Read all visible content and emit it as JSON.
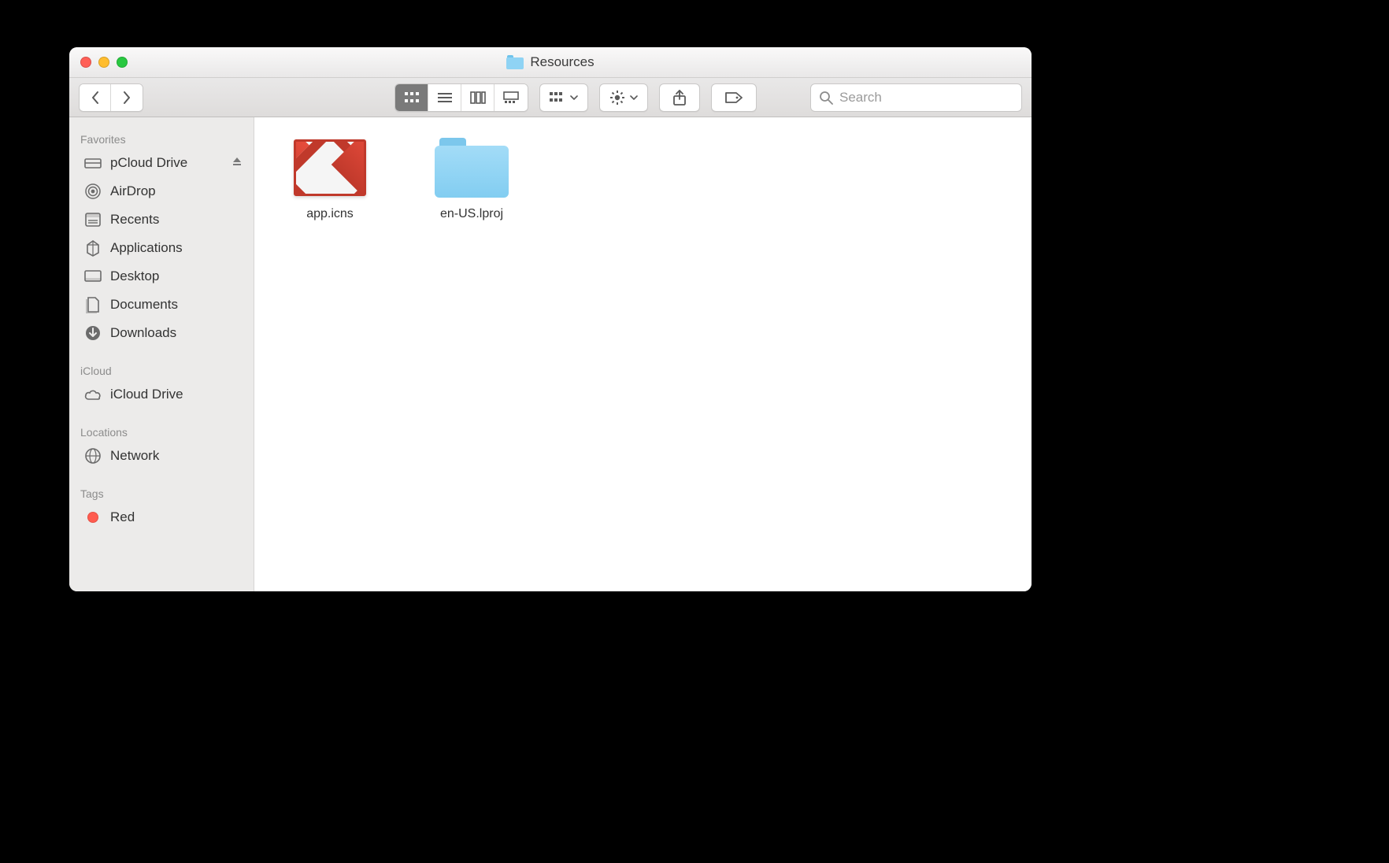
{
  "window_title": "Resources",
  "search": {
    "placeholder": "Search"
  },
  "sidebar": {
    "sections": {
      "favorites_label": "Favorites",
      "icloud_label": "iCloud",
      "locations_label": "Locations",
      "tags_label": "Tags"
    },
    "favorites": [
      {
        "label": "pCloud Drive",
        "icon": "drive",
        "ejectable": true
      },
      {
        "label": "AirDrop",
        "icon": "airdrop"
      },
      {
        "label": "Recents",
        "icon": "recents"
      },
      {
        "label": "Applications",
        "icon": "apps"
      },
      {
        "label": "Desktop",
        "icon": "desktop"
      },
      {
        "label": "Documents",
        "icon": "documents"
      },
      {
        "label": "Downloads",
        "icon": "downloads"
      }
    ],
    "icloud": [
      {
        "label": "iCloud Drive",
        "icon": "cloud"
      }
    ],
    "locations": [
      {
        "label": "Network",
        "icon": "network"
      }
    ],
    "tags": [
      {
        "label": "Red",
        "color": "#ff5b4f"
      }
    ]
  },
  "items": [
    {
      "name": "app.icns",
      "kind": "gmail-icon"
    },
    {
      "name": "en-US.lproj",
      "kind": "folder"
    }
  ]
}
